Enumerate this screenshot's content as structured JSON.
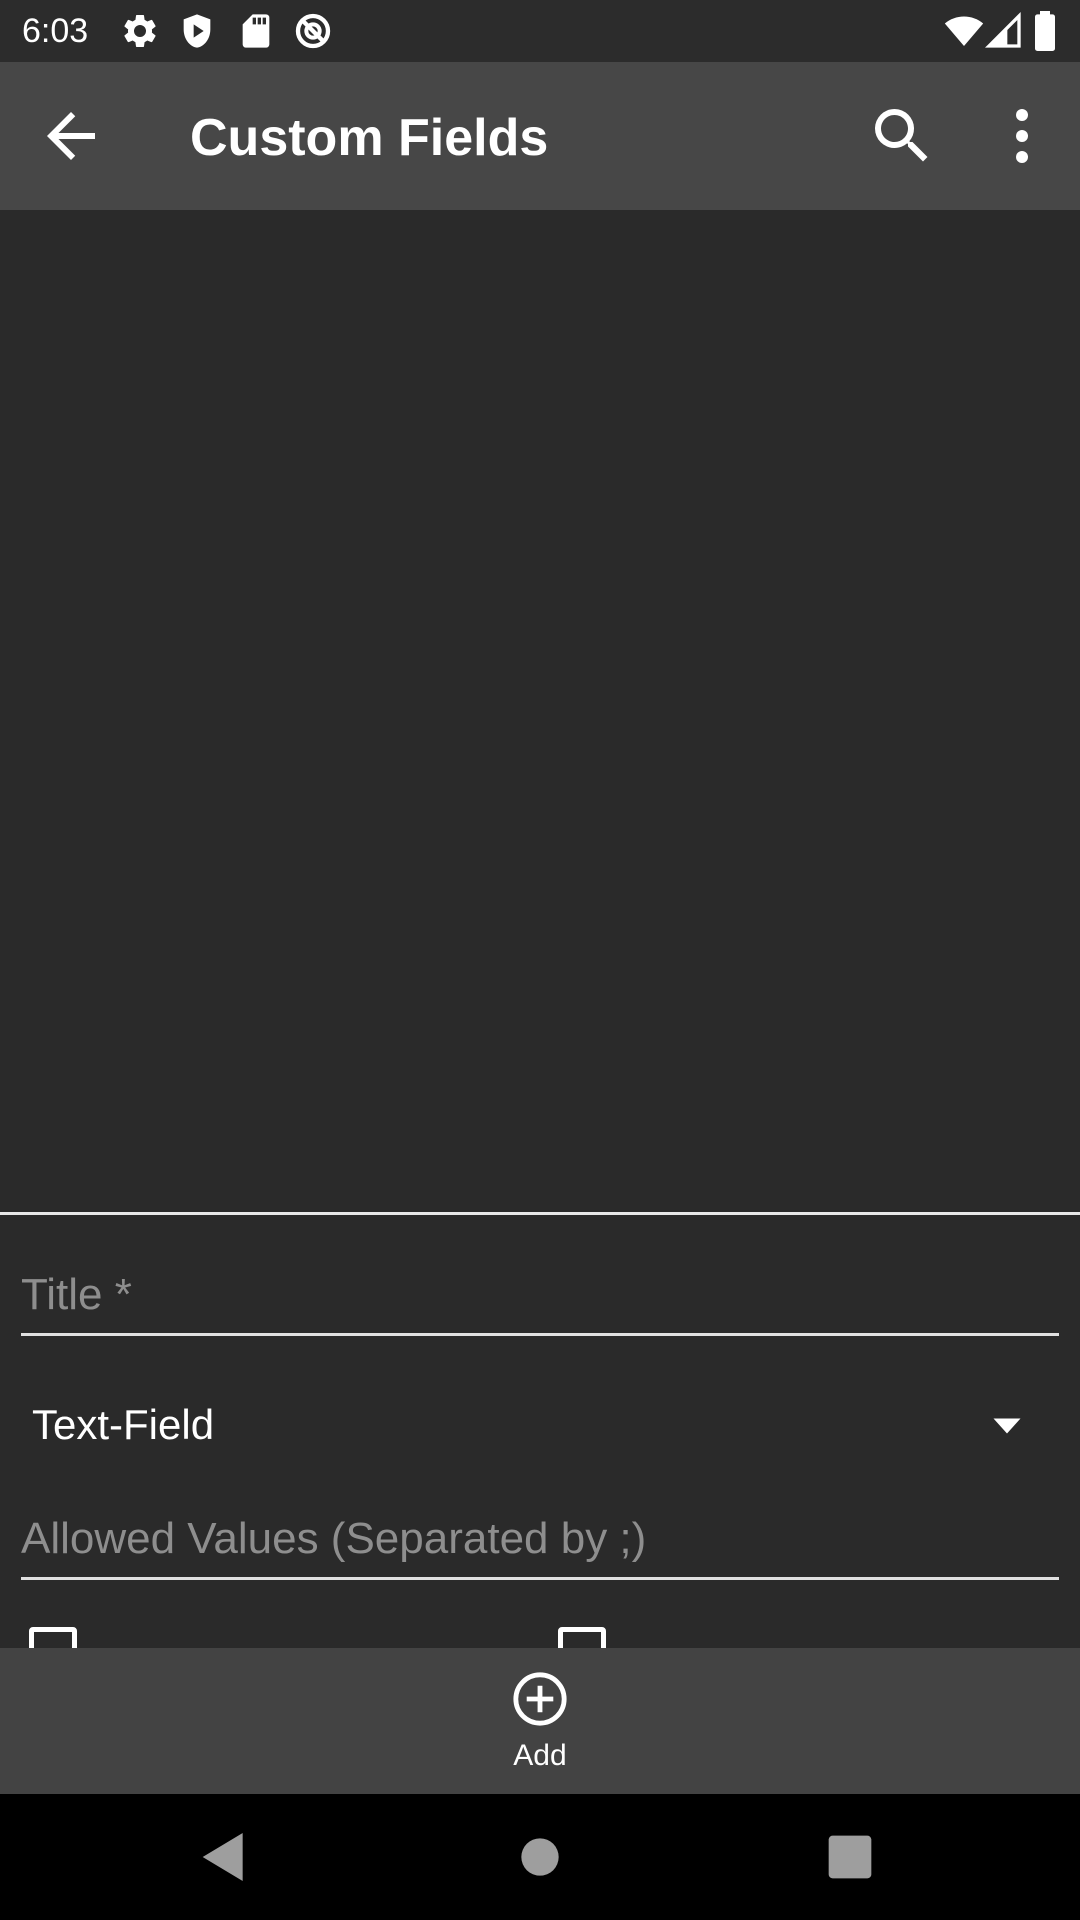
{
  "status_bar": {
    "time": "6:03",
    "left_icons": [
      "settings-icon",
      "shield-icon",
      "sd-card-icon",
      "do-not-disturb-icon"
    ],
    "right_icons": [
      "wifi-icon",
      "cellular-signal-icon",
      "battery-icon"
    ]
  },
  "app_bar": {
    "title": "Custom Fields",
    "navigation_icon": "back-arrow-icon",
    "actions": [
      "search-icon",
      "overflow-menu-icon"
    ],
    "background_color": "#474747"
  },
  "form": {
    "title_input": {
      "value": "",
      "placeholder": "Title *"
    },
    "type_spinner": {
      "selected": "Text-Field"
    },
    "allowed_values_input": {
      "value": "",
      "placeholder": "Allowed Values (Separated by ;)"
    }
  },
  "bottom_bar": {
    "add_label": "Add",
    "add_icon": "add-circle-icon"
  },
  "nav_bar": {
    "buttons": [
      "back-triangle-icon",
      "home-circle-icon",
      "recents-square-icon"
    ]
  },
  "colors": {
    "background": "#2a2a2a",
    "status_bar": "#2c2c2c",
    "bottom_bar": "#434343",
    "placeholder_text": "#8e8e8e",
    "accent_line": "#e0e0e0"
  }
}
